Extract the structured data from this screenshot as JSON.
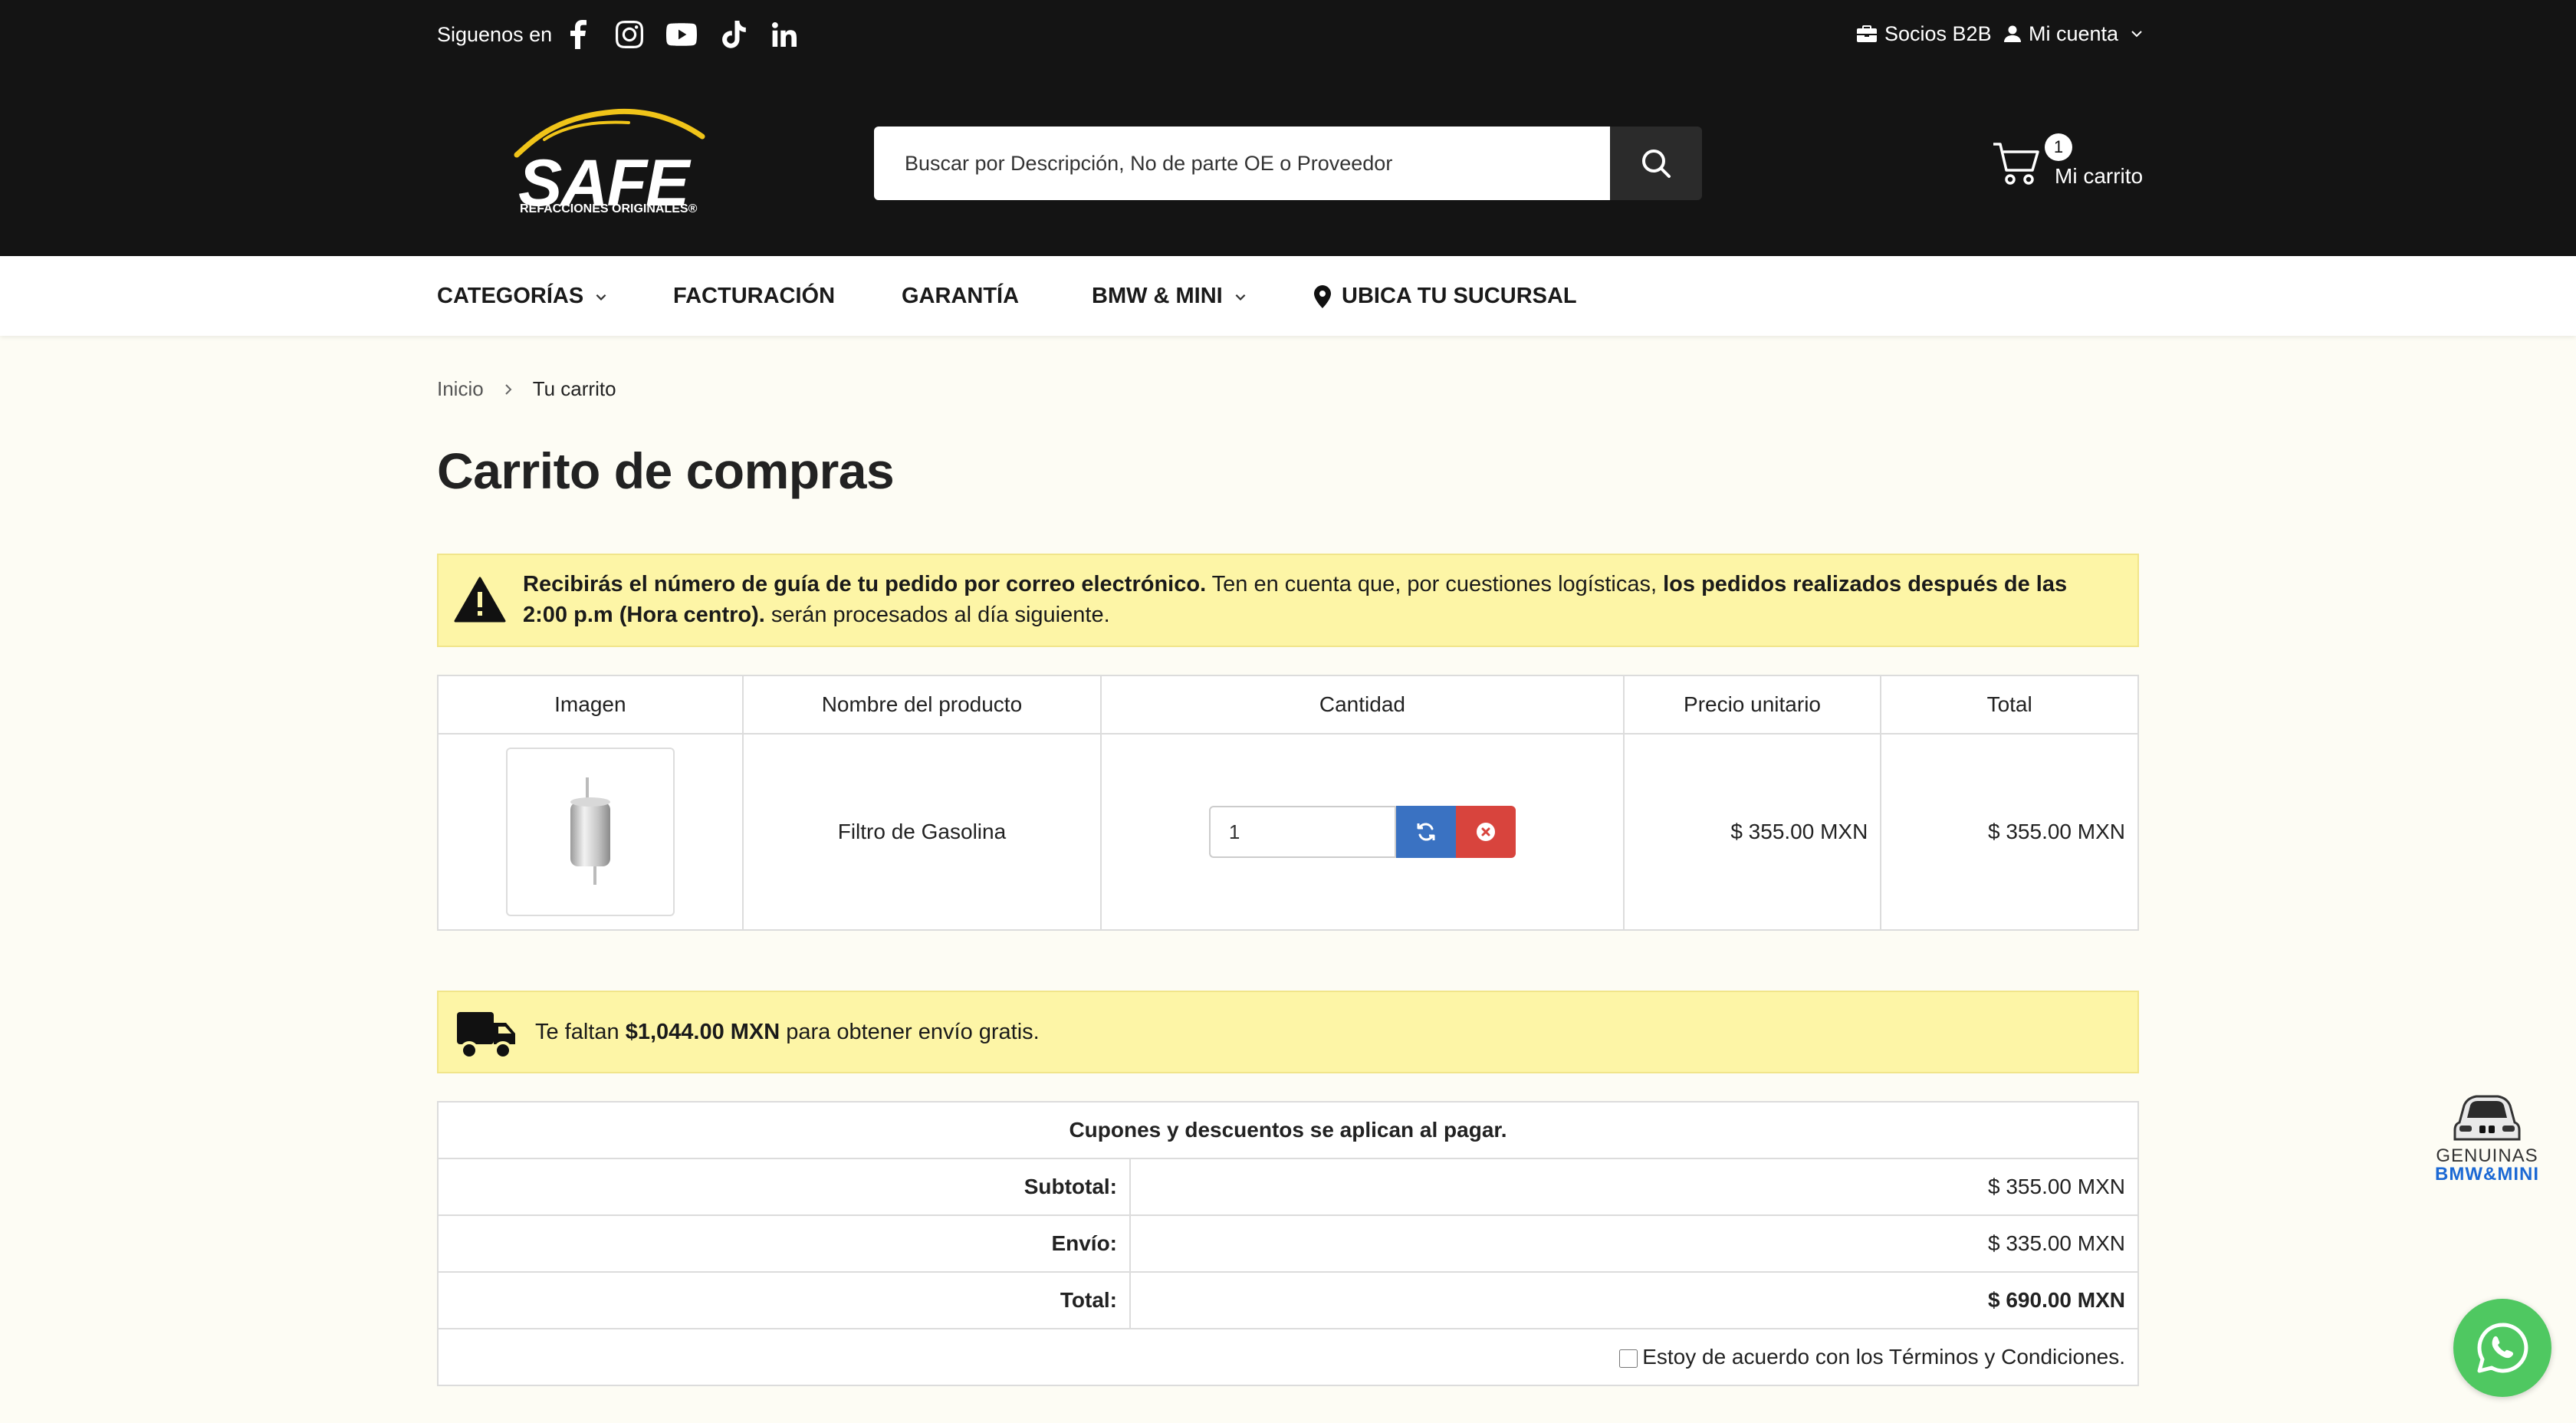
{
  "header": {
    "follow_label": "Siguenos en",
    "social_icons": [
      "facebook-icon",
      "instagram-icon",
      "youtube-icon",
      "tiktok-icon",
      "linkedin-icon"
    ],
    "b2b_label": "Socios B2B",
    "account_label": "Mi cuenta",
    "logo_text": "SAFE",
    "logo_subtext": "REFACCIONES ORIGINALES®",
    "search_placeholder": "Buscar por Descripción, No de parte OE o Proveedor",
    "cart_count": "1",
    "cart_label": "Mi carrito"
  },
  "nav": {
    "categories": "CATEGORÍAS",
    "billing": "FACTURACIÓN",
    "warranty": "GARANTÍA",
    "bmw": "BMW & MINI",
    "branch": "UBICA TU SUCURSAL"
  },
  "breadcrumb": {
    "home": "Inicio",
    "current": "Tu carrito"
  },
  "page_title": "Carrito de compras",
  "alert": {
    "bold1": "Recibirás el número de guía de tu pedido por correo electrónico.",
    "text1": " Ten en cuenta que, por cuestiones logísticas, ",
    "bold2": "los pedidos realizados después de las 2:00 p.m (Hora centro).",
    "text2": " serán procesados al día siguiente."
  },
  "cart_table": {
    "headers": [
      "Imagen",
      "Nombre del producto",
      "Cantidad",
      "Precio unitario",
      "Total"
    ],
    "rows": [
      {
        "name": "Filtro de Gasolina",
        "quantity": "1",
        "unit_price": "$ 355.00 MXN",
        "total": "$ 355.00 MXN"
      }
    ]
  },
  "shipping": {
    "prefix": "Te faltan ",
    "amount": "$1,044.00 MXN",
    "suffix": " para obtener envío gratis."
  },
  "totals": {
    "note": "Cupones y descuentos se aplican al pagar.",
    "subtotal_label": "Subtotal:",
    "subtotal": "$ 355.00 MXN",
    "shipping_label": "Envío:",
    "shipping": "$ 335.00 MXN",
    "total_label": "Total:",
    "total": "$ 690.00 MXN",
    "terms_prefix": "Estoy de acuerdo con los ",
    "terms_link": "Términos y Condiciones",
    "terms_suffix": "."
  },
  "bmw_badge": {
    "line1": "GENUINAS",
    "line2": "BMW&MINI"
  },
  "colors": {
    "header_bg": "#141414",
    "alert_bg": "#fdf5a6",
    "refresh_btn": "#3a72c2",
    "remove_btn": "#d8443d",
    "whatsapp": "#4fc861"
  }
}
